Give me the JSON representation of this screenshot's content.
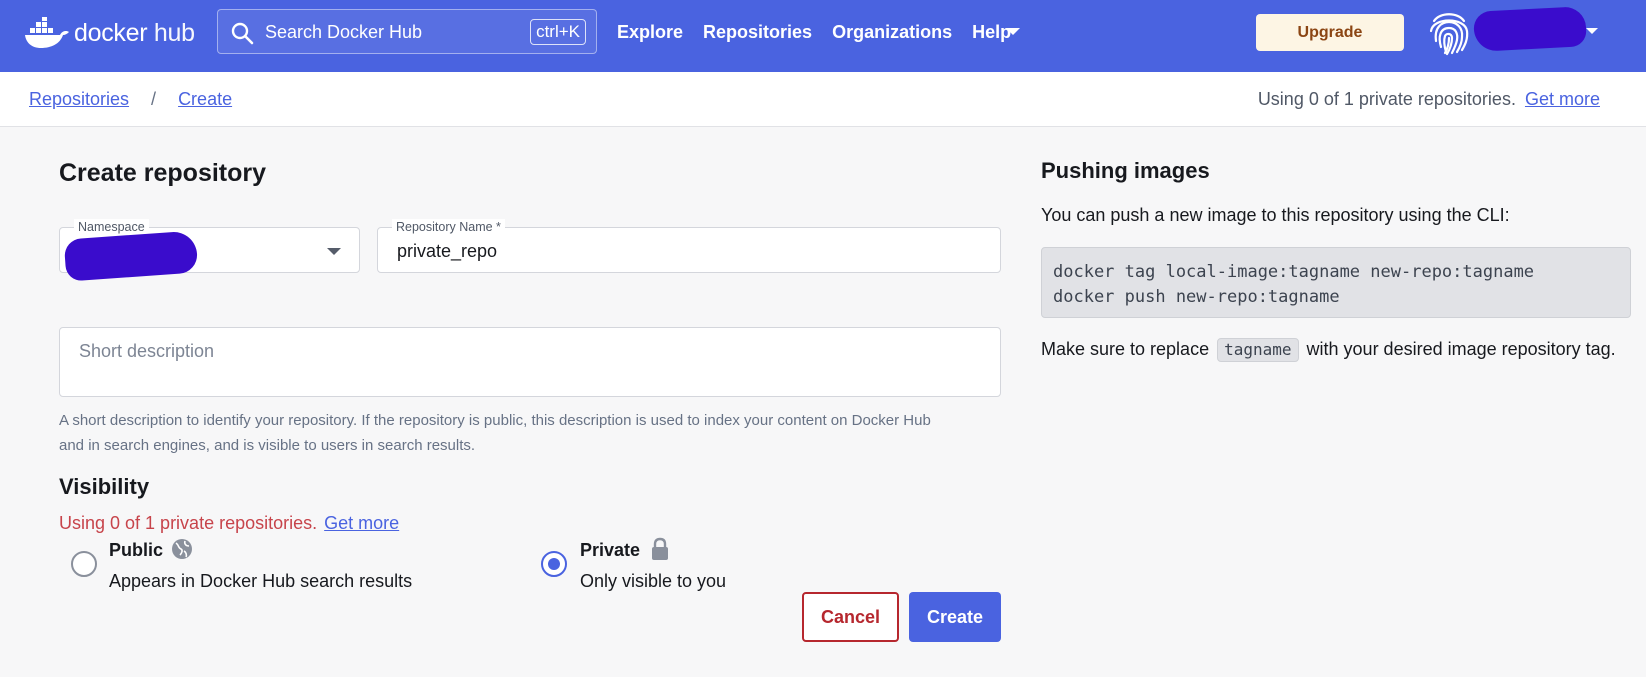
{
  "header": {
    "logo_text": "docker",
    "logo_hub": "hub",
    "search_placeholder": "Search Docker Hub",
    "search_shortcut": "ctrl+K",
    "nav": [
      "Explore",
      "Repositories",
      "Organizations",
      "Help"
    ],
    "upgrade_label": "Upgrade",
    "brand_color": "#4a63e0"
  },
  "breadcrumb": {
    "items": [
      "Repositories",
      "Create"
    ],
    "separator": "/"
  },
  "usage": {
    "text": "Using 0 of 1 private repositories.",
    "link": "Get more"
  },
  "form": {
    "title": "Create repository",
    "namespace_label": "Namespace",
    "repo_name_label": "Repository Name *",
    "repo_name_value": "private_repo",
    "description_placeholder": "Short description",
    "helper_text": "A short description to identify your repository. If the repository is public, this description is used to index your content on Docker Hub and in search engines, and is visible to users in search results.",
    "visibility_title": "Visibility",
    "visibility_usage": "Using 0 of 1 private repositories.",
    "visibility_link": "Get more",
    "options": [
      {
        "title": "Public",
        "subtitle": "Appears in Docker Hub search results",
        "icon": "globe-icon",
        "selected": false
      },
      {
        "title": "Private",
        "subtitle": "Only visible to you",
        "icon": "lock-icon",
        "selected": true
      }
    ],
    "cancel_label": "Cancel",
    "create_label": "Create"
  },
  "push_panel": {
    "title": "Pushing images",
    "intro": "You can push a new image to this repository using the CLI:",
    "code": [
      "docker tag local-image:tagname new-repo:tagname",
      "docker push new-repo:tagname"
    ],
    "note_before": "Make sure to replace",
    "note_code": "tagname",
    "note_after": "with your desired image repository tag."
  }
}
